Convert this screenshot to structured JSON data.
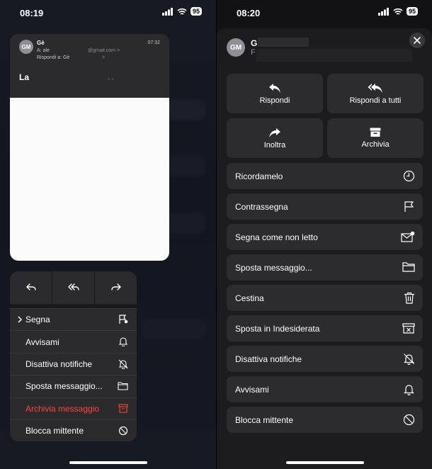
{
  "left": {
    "status": {
      "time": "08:19",
      "battery": "95"
    },
    "email": {
      "avatar": "GM",
      "sender": "Gѐ",
      "to": "A: ale",
      "reply_to": "Rispondi a: Gѐ",
      "gmail": "@gmail.com >",
      "gmail_chev": ">",
      "time": "07:32",
      "subject": "La",
      "dash": "- -"
    },
    "actions": [
      "reply-icon",
      "reply-all-icon",
      "forward-icon"
    ],
    "menu": [
      {
        "label": "Segna",
        "icon": "flag-dot-icon",
        "chevron": ">"
      },
      {
        "label": "Avvisami",
        "icon": "bell-icon"
      },
      {
        "label": "Disattiva notifiche",
        "icon": "bell-slash-icon"
      },
      {
        "label": "Sposta messaggio...",
        "icon": "folder-icon"
      },
      {
        "label": "Archivia messaggio",
        "icon": "archive-icon",
        "color": "#ff453a"
      },
      {
        "label": "Blocca mittente",
        "icon": "block-icon"
      }
    ]
  },
  "right": {
    "status": {
      "time": "08:20",
      "battery": "95"
    },
    "sender": {
      "avatar": "GM",
      "name": "G",
      "from": "F"
    },
    "tiles": [
      {
        "label": "Rispondi",
        "icon": "reply-icon"
      },
      {
        "label": "Rispondi a tutti",
        "icon": "reply-all-icon"
      },
      {
        "label": "Inoltra",
        "icon": "forward-icon"
      },
      {
        "label": "Archivia",
        "icon": "archive-icon"
      }
    ],
    "items": [
      {
        "label": "Ricordamelo",
        "icon": "clock-icon"
      },
      {
        "label": "Contrassegna",
        "icon": "flag-icon"
      },
      {
        "label": "Segna come non letto",
        "icon": "envelope-dot-icon"
      },
      {
        "label": "Sposta messaggio...",
        "icon": "folder-icon"
      },
      {
        "label": "Cestina",
        "icon": "trash-icon"
      },
      {
        "label": "Sposta in Indesiderata",
        "icon": "junk-icon"
      },
      {
        "label": "Disattiva notifiche",
        "icon": "bell-slash-icon"
      },
      {
        "label": "Avvisami",
        "icon": "bell-icon"
      },
      {
        "label": "Blocca mittente",
        "icon": "block-icon"
      }
    ]
  }
}
